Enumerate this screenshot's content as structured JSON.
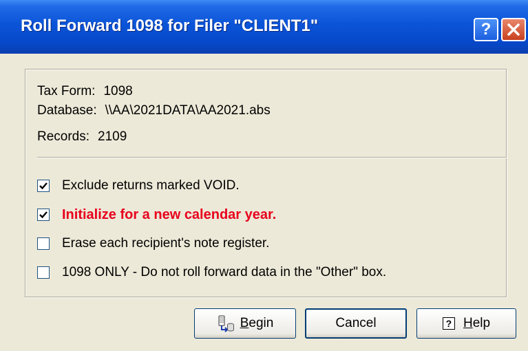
{
  "window": {
    "title": "Roll Forward 1098 for Filer \"CLIENT1\"",
    "help_glyph": "?",
    "close_icon": "close-icon"
  },
  "info": {
    "tax_form_label": "Tax Form:",
    "tax_form_value": "1098",
    "database_label": "Database:",
    "database_value": "\\\\AA\\2021DATA\\AA2021.abs",
    "records_label": "Records:",
    "records_value": "2109"
  },
  "options": [
    {
      "label": "Exclude returns marked VOID.",
      "checked": true
    },
    {
      "label": "Initialize for a new calendar year.",
      "checked": true,
      "highlight_color": "#e8001c"
    },
    {
      "label": "Erase each recipient's note register.",
      "checked": false
    },
    {
      "label": "1098 ONLY - Do not roll forward data in the \"Other\" box.",
      "checked": false
    }
  ],
  "buttons": {
    "begin_first": "B",
    "begin_rest": "egin",
    "cancel": "Cancel",
    "help_glyph": "?",
    "help_first": "H",
    "help_rest": "elp"
  },
  "colors": {
    "titlebar": "#0648c9",
    "dialog_bg": "#ece9d8",
    "checkmark": "#21a121"
  }
}
